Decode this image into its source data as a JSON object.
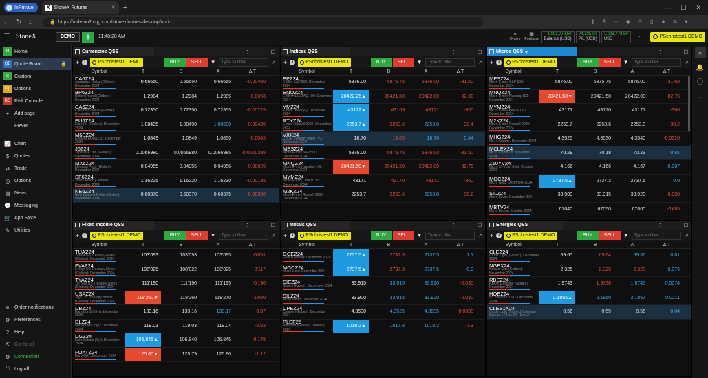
{
  "browser": {
    "inprivate": "InPrivate",
    "tab_title": "StoneX Futures",
    "url": "https://mdemo2.cqg.com/stonexfutures/desktop/main"
  },
  "header": {
    "brand": "StoneX",
    "demo": "DEMO",
    "dollar": "$",
    "time": "11:48:28 AM",
    "orders": "Orders",
    "positions": "Positions",
    "balance_value": "1,093,772.50",
    "balance_label": "Balance (USD)",
    "pl_value": "74,335.00",
    "pl_label": "P/L (USD)",
    "usd_value": "1,093,772.50",
    "usd_label": "USD",
    "account": "PSchristest1 DEMO"
  },
  "sidebar": {
    "top": [
      {
        "box": "H",
        "color": "#2eaa3e",
        "label": "Home"
      },
      {
        "box": "QB",
        "color": "#2a6fc4",
        "label": "Quote Board",
        "active": true,
        "lock": true
      },
      {
        "box": "C",
        "color": "#2eaa3e",
        "label": "Custom"
      },
      {
        "box": "Op",
        "color": "#d8a820",
        "label": "Options"
      },
      {
        "box": "RC",
        "color": "#c0392b",
        "label": "Risk Console"
      }
    ],
    "actions": [
      {
        "ic": "+",
        "label": "Add page"
      },
      {
        "ic": "−",
        "label": "Fewer"
      }
    ],
    "tools": [
      {
        "ic": "📈",
        "label": "Chart"
      },
      {
        "ic": "$",
        "label": "Quotes"
      },
      {
        "ic": "⇄",
        "label": "Trade"
      },
      {
        "ic": "◎",
        "label": "Options"
      },
      {
        "ic": "▤",
        "label": "News"
      },
      {
        "ic": "💬",
        "label": "Messaging"
      },
      {
        "ic": "🛒",
        "label": "App Store"
      },
      {
        "ic": "✎",
        "label": "Utilities"
      }
    ],
    "bottom": [
      {
        "ic": "≡",
        "label": "Order notifications"
      },
      {
        "ic": "⚙",
        "label": "Preferences"
      },
      {
        "ic": "?",
        "label": "Help"
      },
      {
        "ic": "⇱",
        "label": "Go flat all",
        "dim": true
      },
      {
        "ic": "⚙",
        "label": "Connection",
        "conn": true
      },
      {
        "ic": "⎋",
        "label": "Log off"
      }
    ]
  },
  "common": {
    "buy": "BUY",
    "sell": "SELL",
    "filter_placeholder": "Type to filter",
    "col_symbol": "Symbol",
    "col_t": "T",
    "col_b": "B",
    "col_a": "A",
    "col_dt": "Δ T"
  },
  "panels": [
    {
      "title": "Currencies QSS",
      "rows": [
        [
          "DA6Z24",
          "Australian Dollar (Globex): December 2024",
          "0.66650",
          "0.66650",
          "0.66655",
          "-0.00460",
          "",
          "w",
          "w",
          "r"
        ],
        [
          "BP6Z24",
          "British Pound (Globex): December 2024",
          "1.2984",
          "1.2984",
          "1.2985",
          "-0.0066",
          "",
          "w",
          "w",
          "r"
        ],
        [
          "CA6Z24",
          "Canadian Dollar (Globex): December 2024",
          "0.72350",
          "0.72350",
          "0.72355",
          "-0.00225",
          "",
          "w",
          "w",
          "r"
        ],
        [
          "EU6Z24",
          "Euro FX (Globex): December 2024",
          "1.08495",
          "1.08490",
          "1.08500",
          "-0.00435",
          "",
          "w",
          "b",
          "r"
        ],
        [
          "M6EZ24",
          "E-Micro EUR/USD: December 2024",
          "1.0849",
          "1.0849",
          "1.0850",
          "-0.0045",
          "",
          "w",
          "w",
          "r"
        ],
        [
          "J6Z24",
          "Japanese Yen (Globex): December 2024",
          "0.0066980",
          "0.0066980",
          "0.0066985",
          "-0.0000395",
          "",
          "w",
          "w",
          "r"
        ],
        [
          "MX6Z24",
          "Mexican Peso (Globex): December 2024",
          "0.04955",
          "0.04955",
          "0.04956",
          "-0.00025",
          "",
          "w",
          "w",
          "r"
        ],
        [
          "SF6Z24",
          "Swiss Franc (Globex): December 2024",
          "1.16225",
          "1.16220",
          "1.16230",
          "-0.00135",
          "",
          "w",
          "w",
          "r"
        ],
        [
          "NE6Z24",
          "New Zealand Dollar (Globex): December 2024",
          "0.60370",
          "0.60370",
          "0.60375",
          "-0.00380",
          "sel",
          "w",
          "w",
          "r"
        ]
      ]
    },
    {
      "title": "Indices QSS",
      "rows": [
        [
          "EPZ24",
          "E-Mini S&P 500: December 2024",
          "5876.00",
          "5875.75",
          "5876.00",
          "-31.50",
          "",
          "r",
          "r",
          "r"
        ],
        [
          "ENQZ24",
          "E-Mini NASDAQ-100: December 2024",
          "20422.25▲",
          "20421.50",
          "20422.00",
          "-82.00",
          "up",
          "r",
          "r",
          "r"
        ],
        [
          "YMZ24",
          "E-mini Dow ($5): December 2024",
          "43172▲",
          "43169",
          "43171",
          "-360",
          "up",
          "r",
          "r",
          "r"
        ],
        [
          "RTYZ24",
          "E-mini Russell 2000: December 2024",
          "2253.7▲",
          "2253.6",
          "2253.8",
          "-38.4",
          "up",
          "r",
          "b",
          "r"
        ],
        [
          "VXX24",
          "CBOE Volatility Index (VX): November 2024",
          "18.70",
          "18.65",
          "18.70",
          "0.44",
          "sel",
          "r",
          "b",
          "b"
        ],
        [
          "MESZ24",
          "Micro E-mini S&P 500: December 2024",
          "5876.00",
          "5875.75",
          "5876.00",
          "-31.50",
          "",
          "r",
          "r",
          "r"
        ],
        [
          "MNQZ24",
          "Micro E-mini Nasdaq-100: December 2024",
          "20421.50▼",
          "20421.50",
          "20422.00",
          "-82.75",
          "dn",
          "r",
          "r",
          "r"
        ],
        [
          "MYMZ24",
          "Micro E-mini Dow $0.50: December 2024",
          "43171",
          "43170",
          "43171",
          "-360",
          "",
          "r",
          "r",
          "r"
        ],
        [
          "M2KZ24",
          "Micro E-mini Russell 2000: December 2024",
          "2253.7",
          "2253.6",
          "2253.8",
          "-38.2",
          "",
          "r",
          "b",
          "r"
        ]
      ]
    },
    {
      "title": "Micros QSS",
      "rows": [
        [
          "MESZ24",
          "Micro E-mini S&P 500: December 2024",
          "5876.00",
          "5875.75",
          "5876.00",
          "-31.50",
          "",
          "w",
          "w",
          "r"
        ],
        [
          "MNQZ24",
          "Micro E-mini Nasdaq-100: December 2024",
          "20421.50▼",
          "20421.50",
          "20422.00",
          "-82.75",
          "dn",
          "w",
          "w",
          "r"
        ],
        [
          "MYMZ24",
          "Micro E-mini Dow $0.50: December 2024",
          "43171",
          "43170",
          "43171",
          "-360",
          "",
          "w",
          "w",
          "r"
        ],
        [
          "M2KZ24",
          "Micro E-mini Russell 2000: December 2024",
          "2253.7",
          "2253.6",
          "2253.8",
          "-38.2",
          "",
          "w",
          "w",
          "r"
        ],
        [
          "MHGZ24",
          "Micro Copper: December 2024",
          "4.3525",
          "4.3530",
          "4.3540",
          "-0.0320",
          "",
          "w",
          "w",
          "r"
        ],
        [
          "MCLEX24",
          "Micro Crude Oil: November 2024",
          "70.29",
          "70.18",
          "70.23",
          "0.91",
          "sel",
          "w",
          "w",
          "b"
        ],
        [
          "Z10YV24",
          "Micro 10-Year Yield: October 2024",
          "4.166",
          "4.166",
          "4.167",
          "0.087",
          "",
          "w",
          "w",
          "b"
        ],
        [
          "MGCZ24",
          "Micro Gold: December 2024",
          "2737.5▲",
          "2737.3",
          "2737.5",
          "0.9",
          "up",
          "w",
          "w",
          "b"
        ],
        [
          "SILZ24",
          "Micro Silver: December 2024",
          "33.900",
          "33.915",
          "33.920",
          "-0.030",
          "",
          "w",
          "w",
          "r"
        ],
        [
          "MBTV24",
          "Micro Bitcoin: October 2024",
          "67040",
          "67050",
          "67060",
          "-1495",
          "",
          "w",
          "w",
          "r"
        ]
      ]
    },
    {
      "title": "Fixed Income QSS",
      "rows": [
        [
          "TUAZ24",
          "2-Year US Treasury Notes (Globex): December 2024",
          "103'093",
          "103'093",
          "103'095",
          "-0'051",
          "",
          "w",
          "w",
          "r"
        ],
        [
          "FVAZ24",
          "5-Year US Treasury Notes (Globex): December 2024",
          "108'025",
          "108'022",
          "108'025",
          "-0'117",
          "",
          "w",
          "w",
          "r"
        ],
        [
          "TYAZ24",
          "10-Year US Treasury Notes (Globex): December 2024",
          "111'190",
          "111'190",
          "111'195",
          "-0'190",
          "",
          "w",
          "w",
          "r"
        ],
        [
          "USAZ24",
          "30yr US Treasury Bonds (Globex): December 2024",
          "118'260▼",
          "118'260",
          "118'270",
          "-1'080",
          "dn",
          "w",
          "w",
          "r"
        ],
        [
          "DBZ24",
          "Euro Bund (10yr): December 2024",
          "133.16",
          "133.16",
          "133.17",
          "-0.97",
          "",
          "w",
          "b",
          "r"
        ],
        [
          "DLZ24",
          "Euro BOBL (5yr): December 2024",
          "119.03",
          "119.03",
          "119.04",
          "-0.52",
          "",
          "w",
          "w",
          "r"
        ],
        [
          "DGZ24",
          "Euro Schatz (2yr): December 2024",
          "106.845▲",
          "106.840",
          "106.845",
          "-0.145",
          "up",
          "w",
          "w",
          "r"
        ],
        [
          "FOATZ24",
          "Euro-OAT: December 2024",
          "125.80▼",
          "125.79",
          "125.80",
          "-1.12",
          "dn",
          "w",
          "w",
          "r"
        ]
      ]
    },
    {
      "title": "Metals QSS",
      "rows": [
        [
          "GCEZ24",
          "Gold (Globex): December 2024",
          "2737.5▲",
          "2737.3",
          "2737.5",
          "1.1",
          "up",
          "r",
          "b",
          "b"
        ],
        [
          "MGCZ24",
          "Micro Gold: December 2024",
          "2737.5▲",
          "2737.3",
          "2737.5",
          "0.9",
          "up",
          "r",
          "b",
          "b"
        ],
        [
          "SIEZ24",
          "Silver (Globex): December 2024",
          "33.915",
          "33.915",
          "33.920",
          "-0.030",
          "",
          "b",
          "b",
          "r"
        ],
        [
          "SILZ24",
          "Micro Silver: December 2024",
          "33.900",
          "33.915",
          "33.920",
          "-0.030",
          "",
          "b",
          "b",
          "r"
        ],
        [
          "CPEZ24",
          "Copper (Globex): December 2024",
          "4.3530",
          "4.3525",
          "4.3535",
          "-0.0390",
          "",
          "b",
          "b",
          "r"
        ],
        [
          "PLEF25",
          "Platinum (Globex): January 2025",
          "1018.2▲",
          "1017.8",
          "1018.2",
          "-7.3",
          "up",
          "b",
          "b",
          "r"
        ]
      ]
    },
    {
      "title": "Energies QSS",
      "rows": [
        [
          "CLEZ24",
          "Crude Light (Globex): December 2024",
          "69.65",
          "69.64",
          "69.66",
          "0.81",
          "",
          "r",
          "b",
          "b"
        ],
        [
          "NGEX24",
          "Natural Gas (Globex): November 2024",
          "2.326",
          "2.325",
          "2.328",
          "0.076",
          "",
          "r",
          "r",
          "b"
        ],
        [
          "RBEZ24",
          "RBOB Gasoline (Globex): December 2024",
          "1.9743",
          "1.9738",
          "1.9745",
          "0.0074",
          "",
          "r",
          "b",
          "b"
        ],
        [
          "HOEZ24",
          "NY Harbor ULSD: December 2024",
          "2.1855▲",
          "2.1850",
          "2.1857",
          "0.0211",
          "up",
          "b",
          "b",
          "b"
        ],
        [
          "CLES1X24",
          "Crude Light (Globex) Calendar Spread 1 / Nov 24 - Dec 24",
          "0.56",
          "0.55",
          "0.56",
          "0.04",
          "sel",
          "w",
          "w",
          "b"
        ]
      ]
    }
  ]
}
